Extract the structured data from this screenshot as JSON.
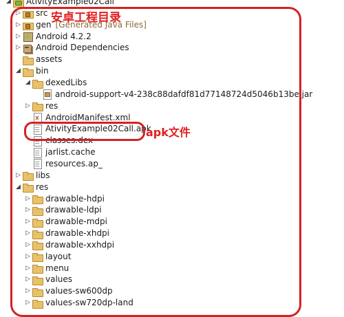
{
  "tree": [
    {
      "label": "AtivityExample02Call",
      "depth": 0,
      "arrow": "down",
      "icon": "root",
      "y": -6
    },
    {
      "label": "src",
      "depth": 1,
      "arrow": "right",
      "icon": "srcfolder"
    },
    {
      "label": "gen",
      "extra": "[Generated Java Files]",
      "depth": 1,
      "arrow": "right",
      "icon": "srcfolder"
    },
    {
      "label": "Android 4.2.2",
      "depth": 1,
      "arrow": "right",
      "icon": "android"
    },
    {
      "label": "Android Dependencies",
      "depth": 1,
      "arrow": "right",
      "icon": "lib"
    },
    {
      "label": "assets",
      "depth": 1,
      "arrow": "",
      "icon": "folder"
    },
    {
      "label": "bin",
      "depth": 1,
      "arrow": "down",
      "icon": "folder"
    },
    {
      "label": "dexedLibs",
      "depth": 2,
      "arrow": "down",
      "icon": "folder"
    },
    {
      "label": "android-support-v4-238c88dafdf81d77148724d5046b13be.jar",
      "depth": 3,
      "arrow": "",
      "icon": "jar"
    },
    {
      "label": "res",
      "depth": 2,
      "arrow": "right",
      "icon": "folder"
    },
    {
      "label": "AndroidManifest.xml",
      "depth": 2,
      "arrow": "",
      "icon": "xml"
    },
    {
      "label": "AtivityExample02Call.apk",
      "depth": 2,
      "arrow": "",
      "icon": "file"
    },
    {
      "label": "classes.dex",
      "depth": 2,
      "arrow": "",
      "icon": "file"
    },
    {
      "label": "jarlist.cache",
      "depth": 2,
      "arrow": "",
      "icon": "file"
    },
    {
      "label": "resources.ap_",
      "depth": 2,
      "arrow": "",
      "icon": "file"
    },
    {
      "label": "libs",
      "depth": 1,
      "arrow": "right",
      "icon": "folder"
    },
    {
      "label": "res",
      "depth": 1,
      "arrow": "down",
      "icon": "folder"
    },
    {
      "label": "drawable-hdpi",
      "depth": 2,
      "arrow": "right",
      "icon": "folder"
    },
    {
      "label": "drawable-ldpi",
      "depth": 2,
      "arrow": "right",
      "icon": "folder"
    },
    {
      "label": "drawable-mdpi",
      "depth": 2,
      "arrow": "right",
      "icon": "folder"
    },
    {
      "label": "drawable-xhdpi",
      "depth": 2,
      "arrow": "right",
      "icon": "folder"
    },
    {
      "label": "drawable-xxhdpi",
      "depth": 2,
      "arrow": "right",
      "icon": "folder"
    },
    {
      "label": "layout",
      "depth": 2,
      "arrow": "right",
      "icon": "folder"
    },
    {
      "label": "menu",
      "depth": 2,
      "arrow": "right",
      "icon": "folder"
    },
    {
      "label": "values",
      "depth": 2,
      "arrow": "right",
      "icon": "folder"
    },
    {
      "label": "values-sw600dp",
      "depth": 2,
      "arrow": "right",
      "icon": "folder"
    },
    {
      "label": "values-sw720dp-land",
      "depth": 2,
      "arrow": "right",
      "icon": "folder"
    }
  ],
  "annotations": {
    "project_dir_label": "安卓工程目录",
    "apk_label": "apk文件"
  },
  "colors": {
    "annotation": "#d62020",
    "extra_text": "#8a6a3a"
  }
}
